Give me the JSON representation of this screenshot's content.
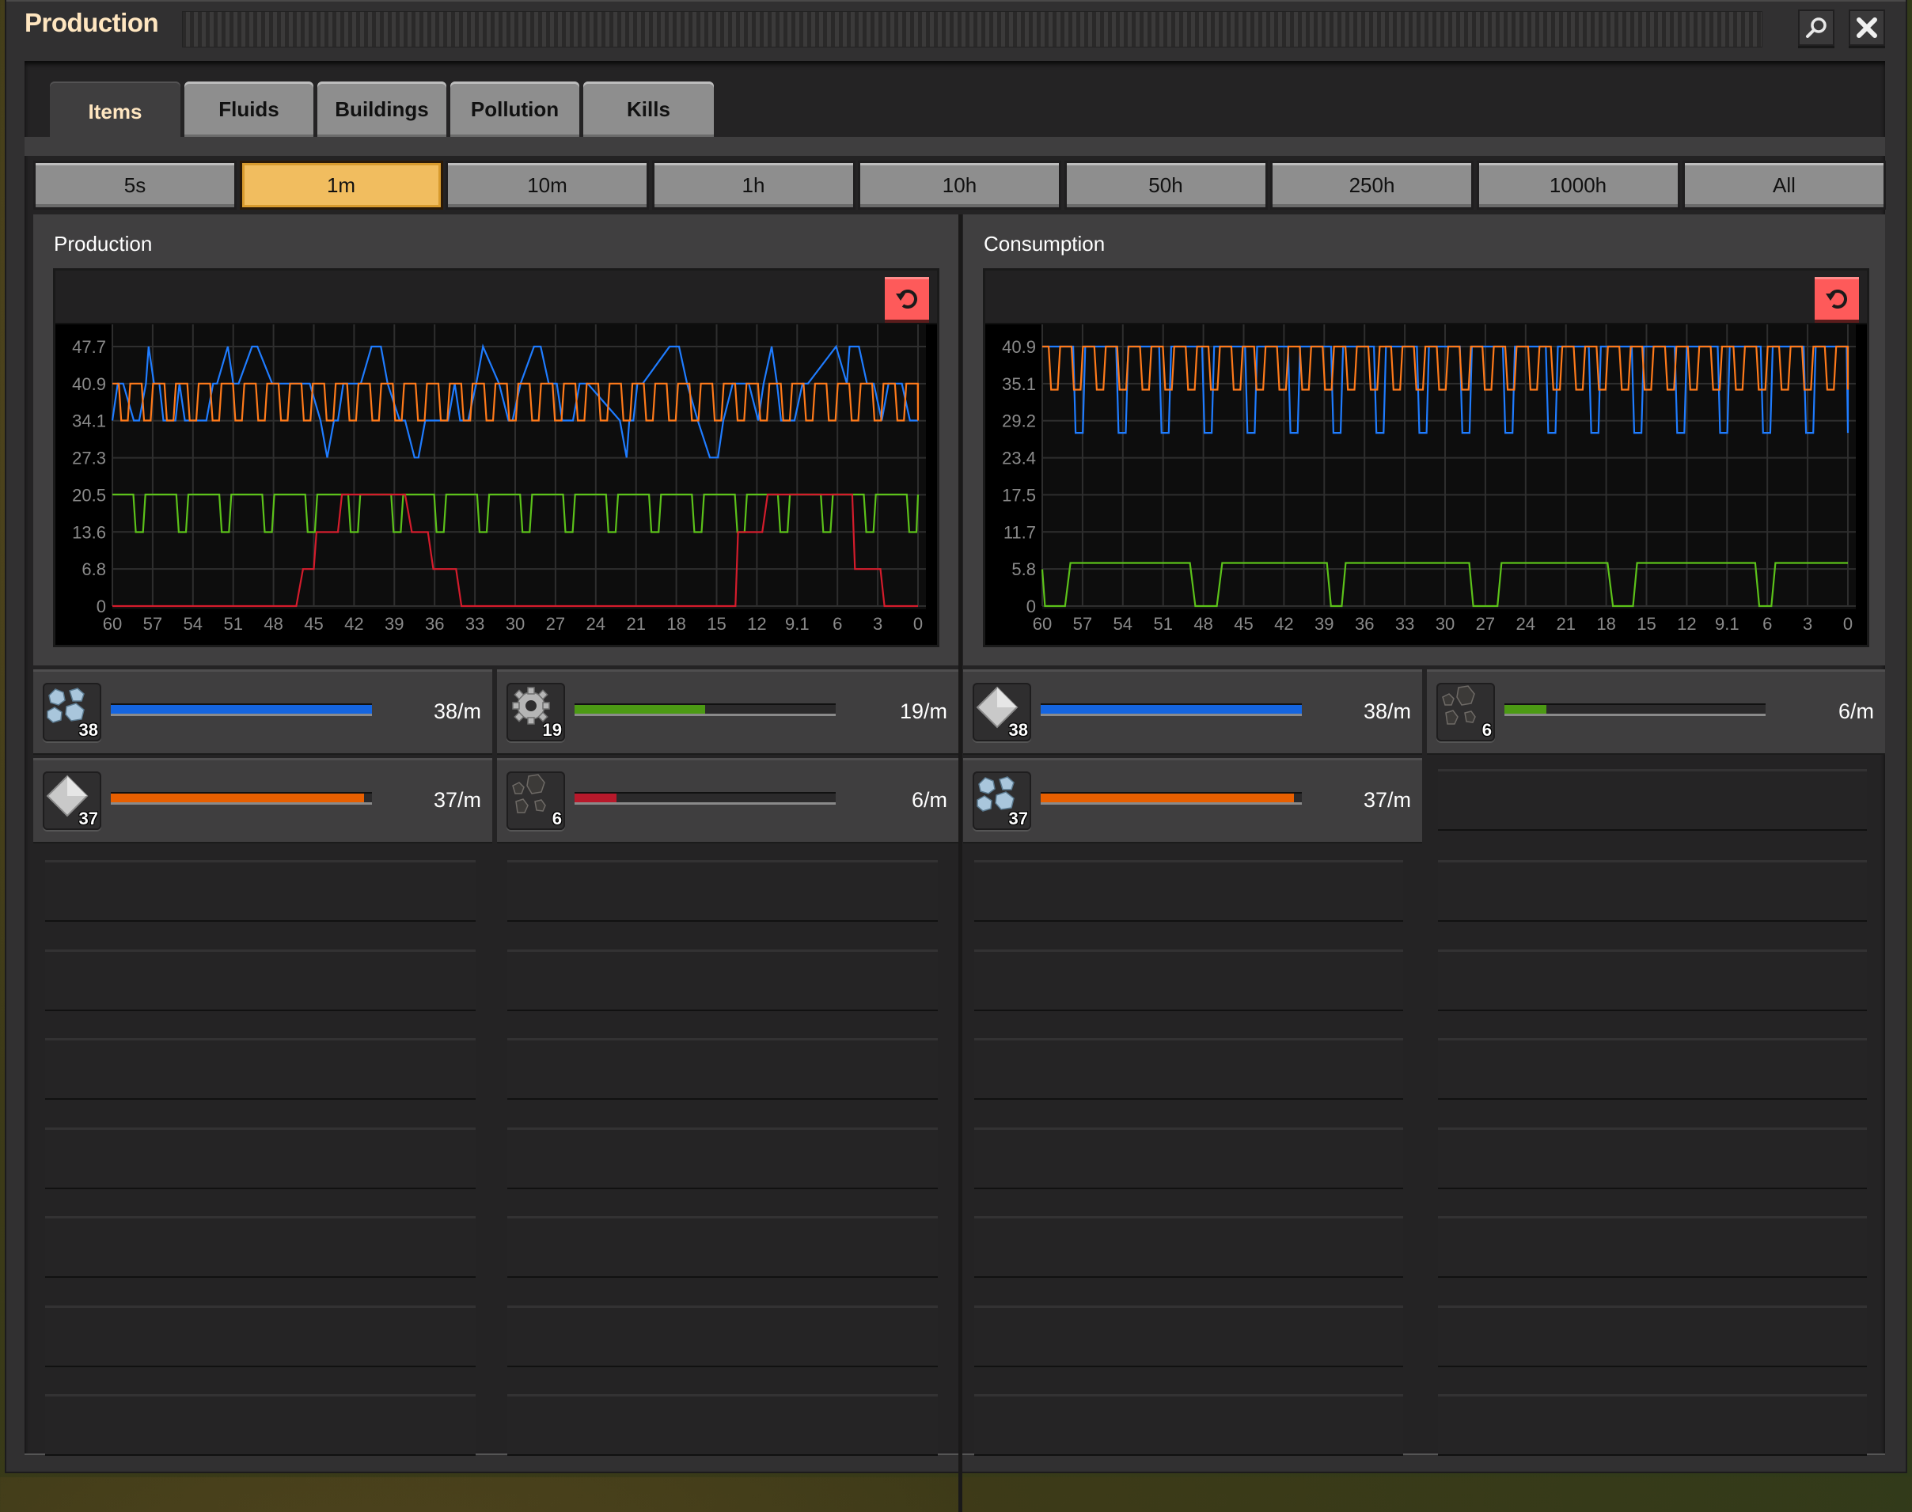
{
  "window": {
    "title": "Production",
    "search_icon": "search-icon",
    "close_icon": "close-icon"
  },
  "tabs": [
    {
      "label": "Items",
      "active": true
    },
    {
      "label": "Fluids",
      "active": false
    },
    {
      "label": "Buildings",
      "active": false
    },
    {
      "label": "Pollution",
      "active": false
    },
    {
      "label": "Kills",
      "active": false
    }
  ],
  "time_ranges": [
    {
      "label": "5s",
      "selected": false
    },
    {
      "label": "1m",
      "selected": true
    },
    {
      "label": "10m",
      "selected": false
    },
    {
      "label": "1h",
      "selected": false
    },
    {
      "label": "10h",
      "selected": false
    },
    {
      "label": "50h",
      "selected": false
    },
    {
      "label": "250h",
      "selected": false
    },
    {
      "label": "1000h",
      "selected": false
    },
    {
      "label": "All",
      "selected": false
    }
  ],
  "colors": {
    "accent_selected": "#f1bd5f",
    "reset_button": "#fe5a5a",
    "series_blue": "#1f7cff",
    "series_orange": "#ff7a1a",
    "series_green": "#5cc21a",
    "series_red": "#d41c2c",
    "bar_blue": "#1565e0",
    "bar_green": "#4c9a14",
    "bar_orange": "#e85f00",
    "bar_red": "#b8192b"
  },
  "production": {
    "title": "Production",
    "reset_icon": "reset-icon",
    "items": [
      {
        "name": "Iron ore",
        "icon": "iron-ore-icon",
        "count": "38",
        "rate": "38/m",
        "fill": 1.0,
        "bar_color": "#1565e0"
      },
      {
        "name": "Iron gear wheel",
        "icon": "iron-gear-wheel-icon",
        "count": "19",
        "rate": "19/m",
        "fill": 0.5,
        "bar_color": "#4c9a14"
      },
      {
        "name": "Iron plate",
        "icon": "iron-plate-icon",
        "count": "37",
        "rate": "37/m",
        "fill": 0.97,
        "bar_color": "#e85f00"
      },
      {
        "name": "Coal",
        "icon": "coal-icon",
        "count": "6",
        "rate": "6/m",
        "fill": 0.16,
        "bar_color": "#b8192b"
      }
    ]
  },
  "consumption": {
    "title": "Consumption",
    "reset_icon": "reset-icon",
    "items": [
      {
        "name": "Iron plate",
        "icon": "iron-plate-icon",
        "count": "38",
        "rate": "38/m",
        "fill": 1.0,
        "bar_color": "#1565e0"
      },
      {
        "name": "Coal",
        "icon": "coal-icon",
        "count": "6",
        "rate": "6/m",
        "fill": 0.16,
        "bar_color": "#4c9a14"
      },
      {
        "name": "Iron ore",
        "icon": "iron-ore-icon",
        "count": "37",
        "rate": "37/m",
        "fill": 0.97,
        "bar_color": "#e85f00"
      }
    ]
  },
  "chart_data": [
    {
      "type": "line",
      "title": "Production",
      "xlabel": "",
      "ylabel": "",
      "x_ticks": [
        "60",
        "57",
        "54",
        "51",
        "48",
        "45",
        "42",
        "39",
        "36",
        "33",
        "30",
        "27",
        "24",
        "21",
        "18",
        "15",
        "12",
        "9.1",
        "6",
        "3",
        "0"
      ],
      "y_ticks": [
        "0",
        "6.8",
        "13.6",
        "20.5",
        "27.3",
        "34.1",
        "40.9",
        "47.7"
      ],
      "xlim": [
        60,
        0
      ],
      "ylim": [
        0,
        47.7
      ],
      "grid": true,
      "series": [
        {
          "name": "Iron ore",
          "color": "#1f7cff",
          "x": [
            60,
            59.6,
            59.2,
            58.4,
            58,
            57.5,
            57.3,
            56.9,
            56.5,
            56.2,
            55.3,
            55,
            54.6,
            54,
            53,
            52.5,
            52.2,
            51.4,
            51,
            50.6,
            49.6,
            49.2,
            48.1,
            47.6,
            47.2,
            45.3,
            44.5,
            44,
            43.5,
            43.2,
            42.8,
            42.5,
            41.5,
            40.7,
            40,
            39.5,
            38.6,
            38.2,
            37.5,
            37.2,
            36.7,
            35,
            34.5,
            34.1,
            33.5,
            32.9,
            32.4,
            31.2,
            30.5,
            30.2,
            29.6,
            28.6,
            28.1,
            27.5,
            26.9,
            26.5,
            25.7,
            25.2,
            24.8,
            24.6,
            22.2,
            21.7,
            21.5,
            21.2,
            20.9,
            20.5,
            18.5,
            17.8,
            17.2,
            16.4,
            15.5,
            14.9,
            14.5,
            13.8,
            12.6,
            11.9,
            11.5,
            10.9,
            10.5,
            10.2,
            9.2,
            8.6,
            8.2,
            6.1,
            5.3,
            5.1,
            4.4,
            3.8,
            3.3,
            2.7,
            2.2,
            1.7,
            1.2,
            0.6,
            0
          ],
          "y": [
            34.1,
            40.9,
            40.9,
            34.1,
            34.1,
            40.9,
            47.7,
            40.9,
            40.9,
            34.1,
            34.1,
            40.9,
            34.1,
            34.1,
            34.1,
            40.9,
            40.9,
            47.7,
            40.9,
            40.9,
            47.7,
            47.7,
            40.9,
            40.9,
            40.9,
            40.9,
            34.1,
            27.3,
            34.1,
            34.1,
            40.9,
            40.9,
            40.9,
            47.7,
            47.7,
            40.9,
            34.1,
            34.1,
            27.3,
            27.3,
            34.1,
            34.1,
            40.9,
            34.1,
            34.1,
            40.9,
            47.7,
            40.9,
            34.1,
            34.1,
            40.9,
            47.7,
            47.7,
            40.9,
            40.9,
            34.1,
            34.1,
            40.9,
            40.9,
            40.9,
            34.1,
            27.3,
            34.1,
            34.1,
            40.9,
            40.9,
            47.7,
            47.7,
            40.9,
            34.1,
            27.3,
            27.3,
            34.1,
            40.9,
            40.9,
            34.1,
            40.9,
            47.7,
            40.9,
            34.1,
            34.1,
            40.9,
            40.9,
            47.7,
            40.9,
            47.7,
            47.7,
            40.9,
            40.9,
            34.1,
            40.9,
            40.9,
            40.9,
            34.1,
            34.1
          ]
        },
        {
          "name": "Iron plate",
          "color": "#ff7a1a",
          "pattern": "square wave between 34.1 and 40.9, period ~1.7",
          "low": 34.1,
          "high": 40.9,
          "period": 1.7
        },
        {
          "name": "Iron gear wheel",
          "color": "#5cc21a",
          "pattern": "mostly 20.5 with periodic dips to 13.6, period ~3.2",
          "low": 13.6,
          "high": 20.5,
          "period": 3.2
        },
        {
          "name": "Coal",
          "color": "#d41c2c",
          "x": [
            60,
            46.3,
            45.8,
            45.0,
            44.8,
            43.2,
            42.9,
            38.2,
            37.7,
            36.5,
            36.1,
            34.4,
            34.0,
            13.6,
            13.4,
            11.6,
            11.2,
            4.9,
            4.7,
            2.8,
            2.5,
            0
          ],
          "y": [
            0,
            0,
            6.8,
            6.8,
            13.6,
            13.6,
            20.5,
            20.5,
            13.6,
            13.6,
            6.8,
            6.8,
            0,
            0,
            13.6,
            13.6,
            20.5,
            20.5,
            6.8,
            6.8,
            0,
            0
          ]
        }
      ]
    },
    {
      "type": "line",
      "title": "Consumption",
      "xlabel": "",
      "ylabel": "",
      "x_ticks": [
        "60",
        "57",
        "54",
        "51",
        "48",
        "45",
        "42",
        "39",
        "36",
        "33",
        "30",
        "27",
        "24",
        "21",
        "18",
        "15",
        "12",
        "9.1",
        "6",
        "3",
        "0"
      ],
      "y_ticks": [
        "0",
        "5.8",
        "11.7",
        "17.5",
        "23.4",
        "29.2",
        "35.1",
        "40.9"
      ],
      "xlim": [
        60,
        0
      ],
      "ylim": [
        0,
        40.9
      ],
      "grid": true,
      "series": [
        {
          "name": "Iron plate",
          "color": "#1f7cff",
          "pattern": "mostly 40.9 with periodic dips to 27.3, period ~3.2",
          "low": 27.3,
          "high": 40.9,
          "period": 3.2
        },
        {
          "name": "Iron ore",
          "color": "#ff7a1a",
          "pattern": "square wave between 34.1 and 40.9, period ~1.7",
          "low": 34.1,
          "high": 40.9,
          "period": 1.7
        },
        {
          "name": "Coal",
          "color": "#5cc21a",
          "x": [
            60,
            59.8,
            58.3,
            57.9,
            49.0,
            48.6,
            47.0,
            46.6,
            38.8,
            38.5,
            37.7,
            37.4,
            28.2,
            27.9,
            26.1,
            25.8,
            17.9,
            17.5,
            16.0,
            15.7,
            6.9,
            6.6,
            5.7,
            5.4,
            0
          ],
          "y": [
            5.8,
            0,
            0,
            6.8,
            6.8,
            0,
            0,
            6.8,
            6.8,
            0,
            0,
            6.8,
            6.8,
            0,
            0,
            6.8,
            6.8,
            0,
            0,
            6.8,
            6.8,
            0,
            0,
            6.8,
            6.8
          ]
        }
      ]
    }
  ]
}
